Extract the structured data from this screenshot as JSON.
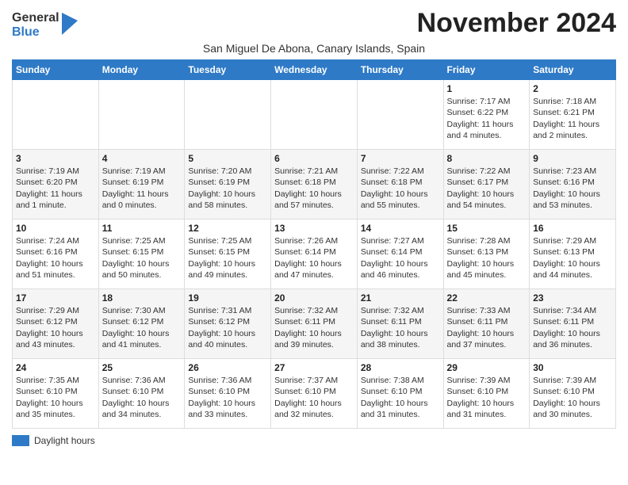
{
  "logo": {
    "general": "General",
    "blue": "Blue"
  },
  "title": "November 2024",
  "subtitle": "San Miguel De Abona, Canary Islands, Spain",
  "days_of_week": [
    "Sunday",
    "Monday",
    "Tuesday",
    "Wednesday",
    "Thursday",
    "Friday",
    "Saturday"
  ],
  "weeks": [
    [
      {
        "day": "",
        "info": ""
      },
      {
        "day": "",
        "info": ""
      },
      {
        "day": "",
        "info": ""
      },
      {
        "day": "",
        "info": ""
      },
      {
        "day": "",
        "info": ""
      },
      {
        "day": "1",
        "info": "Sunrise: 7:17 AM\nSunset: 6:22 PM\nDaylight: 11 hours and 4 minutes."
      },
      {
        "day": "2",
        "info": "Sunrise: 7:18 AM\nSunset: 6:21 PM\nDaylight: 11 hours and 2 minutes."
      }
    ],
    [
      {
        "day": "3",
        "info": "Sunrise: 7:19 AM\nSunset: 6:20 PM\nDaylight: 11 hours and 1 minute."
      },
      {
        "day": "4",
        "info": "Sunrise: 7:19 AM\nSunset: 6:19 PM\nDaylight: 11 hours and 0 minutes."
      },
      {
        "day": "5",
        "info": "Sunrise: 7:20 AM\nSunset: 6:19 PM\nDaylight: 10 hours and 58 minutes."
      },
      {
        "day": "6",
        "info": "Sunrise: 7:21 AM\nSunset: 6:18 PM\nDaylight: 10 hours and 57 minutes."
      },
      {
        "day": "7",
        "info": "Sunrise: 7:22 AM\nSunset: 6:18 PM\nDaylight: 10 hours and 55 minutes."
      },
      {
        "day": "8",
        "info": "Sunrise: 7:22 AM\nSunset: 6:17 PM\nDaylight: 10 hours and 54 minutes."
      },
      {
        "day": "9",
        "info": "Sunrise: 7:23 AM\nSunset: 6:16 PM\nDaylight: 10 hours and 53 minutes."
      }
    ],
    [
      {
        "day": "10",
        "info": "Sunrise: 7:24 AM\nSunset: 6:16 PM\nDaylight: 10 hours and 51 minutes."
      },
      {
        "day": "11",
        "info": "Sunrise: 7:25 AM\nSunset: 6:15 PM\nDaylight: 10 hours and 50 minutes."
      },
      {
        "day": "12",
        "info": "Sunrise: 7:25 AM\nSunset: 6:15 PM\nDaylight: 10 hours and 49 minutes."
      },
      {
        "day": "13",
        "info": "Sunrise: 7:26 AM\nSunset: 6:14 PM\nDaylight: 10 hours and 47 minutes."
      },
      {
        "day": "14",
        "info": "Sunrise: 7:27 AM\nSunset: 6:14 PM\nDaylight: 10 hours and 46 minutes."
      },
      {
        "day": "15",
        "info": "Sunrise: 7:28 AM\nSunset: 6:13 PM\nDaylight: 10 hours and 45 minutes."
      },
      {
        "day": "16",
        "info": "Sunrise: 7:29 AM\nSunset: 6:13 PM\nDaylight: 10 hours and 44 minutes."
      }
    ],
    [
      {
        "day": "17",
        "info": "Sunrise: 7:29 AM\nSunset: 6:12 PM\nDaylight: 10 hours and 43 minutes."
      },
      {
        "day": "18",
        "info": "Sunrise: 7:30 AM\nSunset: 6:12 PM\nDaylight: 10 hours and 41 minutes."
      },
      {
        "day": "19",
        "info": "Sunrise: 7:31 AM\nSunset: 6:12 PM\nDaylight: 10 hours and 40 minutes."
      },
      {
        "day": "20",
        "info": "Sunrise: 7:32 AM\nSunset: 6:11 PM\nDaylight: 10 hours and 39 minutes."
      },
      {
        "day": "21",
        "info": "Sunrise: 7:32 AM\nSunset: 6:11 PM\nDaylight: 10 hours and 38 minutes."
      },
      {
        "day": "22",
        "info": "Sunrise: 7:33 AM\nSunset: 6:11 PM\nDaylight: 10 hours and 37 minutes."
      },
      {
        "day": "23",
        "info": "Sunrise: 7:34 AM\nSunset: 6:11 PM\nDaylight: 10 hours and 36 minutes."
      }
    ],
    [
      {
        "day": "24",
        "info": "Sunrise: 7:35 AM\nSunset: 6:10 PM\nDaylight: 10 hours and 35 minutes."
      },
      {
        "day": "25",
        "info": "Sunrise: 7:36 AM\nSunset: 6:10 PM\nDaylight: 10 hours and 34 minutes."
      },
      {
        "day": "26",
        "info": "Sunrise: 7:36 AM\nSunset: 6:10 PM\nDaylight: 10 hours and 33 minutes."
      },
      {
        "day": "27",
        "info": "Sunrise: 7:37 AM\nSunset: 6:10 PM\nDaylight: 10 hours and 32 minutes."
      },
      {
        "day": "28",
        "info": "Sunrise: 7:38 AM\nSunset: 6:10 PM\nDaylight: 10 hours and 31 minutes."
      },
      {
        "day": "29",
        "info": "Sunrise: 7:39 AM\nSunset: 6:10 PM\nDaylight: 10 hours and 31 minutes."
      },
      {
        "day": "30",
        "info": "Sunrise: 7:39 AM\nSunset: 6:10 PM\nDaylight: 10 hours and 30 minutes."
      }
    ]
  ],
  "legend": {
    "label": "Daylight hours"
  }
}
